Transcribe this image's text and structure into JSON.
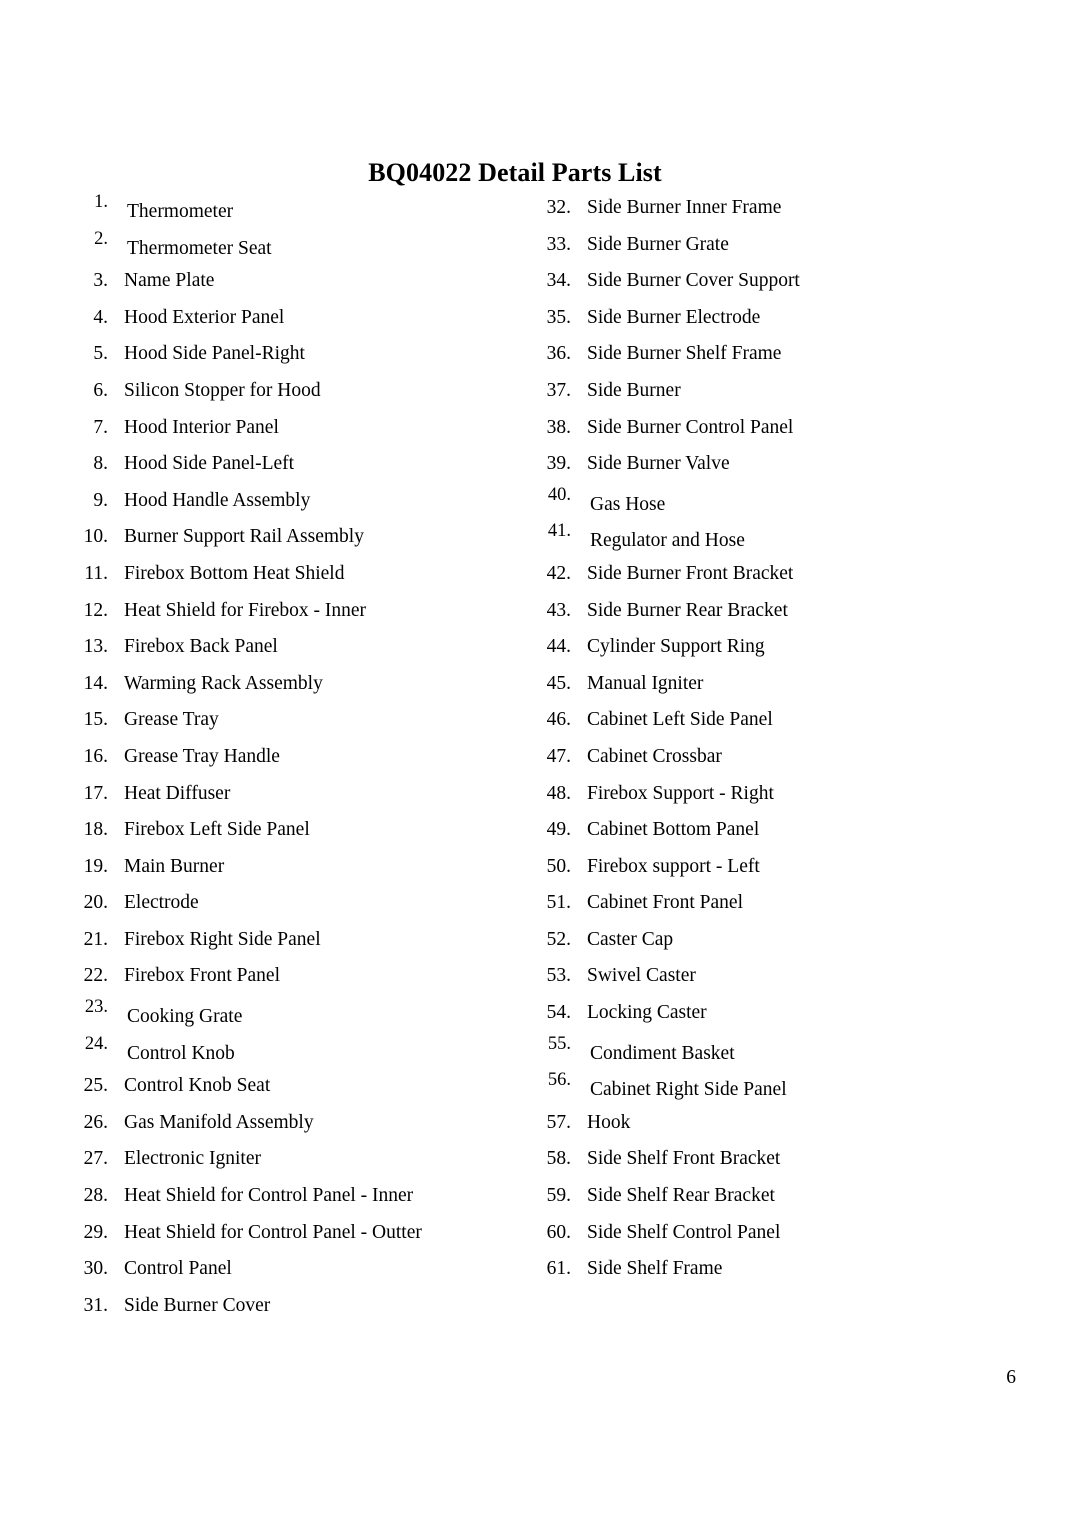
{
  "document": {
    "title": "BQ04022 Detail Parts List",
    "page_number": "6"
  },
  "parts_list": {
    "left_column": [
      {
        "number": "1.",
        "label": "Thermometer",
        "shifted": true
      },
      {
        "number": "2.",
        "label": "Thermometer Seat",
        "shifted": true
      },
      {
        "number": "3.",
        "label": "Name Plate",
        "shifted": false
      },
      {
        "number": "4.",
        "label": "Hood Exterior Panel",
        "shifted": false
      },
      {
        "number": "5.",
        "label": "Hood Side Panel-Right",
        "shifted": false
      },
      {
        "number": "6.",
        "label": "Silicon Stopper for Hood",
        "shifted": false
      },
      {
        "number": "7.",
        "label": "Hood Interior Panel",
        "shifted": false
      },
      {
        "number": "8.",
        "label": "Hood Side Panel-Left",
        "shifted": false
      },
      {
        "number": "9.",
        "label": "Hood Handle Assembly",
        "shifted": false
      },
      {
        "number": "10.",
        "label": "Burner Support Rail Assembly",
        "shifted": false
      },
      {
        "number": "11.",
        "label": "Firebox Bottom Heat Shield",
        "shifted": false
      },
      {
        "number": "12.",
        "label": "Heat Shield for Firebox - Inner",
        "shifted": false
      },
      {
        "number": "13.",
        "label": "Firebox Back Panel",
        "shifted": false
      },
      {
        "number": "14.",
        "label": "Warming Rack Assembly",
        "shifted": false
      },
      {
        "number": "15.",
        "label": "Grease Tray",
        "shifted": false
      },
      {
        "number": "16.",
        "label": "Grease Tray Handle",
        "shifted": false
      },
      {
        "number": "17.",
        "label": "Heat Diffuser",
        "shifted": false
      },
      {
        "number": "18.",
        "label": "Firebox Left Side Panel",
        "shifted": false
      },
      {
        "number": "19.",
        "label": "Main Burner",
        "shifted": false
      },
      {
        "number": "20.",
        "label": "Electrode",
        "shifted": false
      },
      {
        "number": "21.",
        "label": "Firebox Right Side Panel",
        "shifted": false
      },
      {
        "number": "22.",
        "label": "Firebox Front Panel",
        "shifted": false
      },
      {
        "number": "23.",
        "label": "Cooking Grate",
        "shifted": true
      },
      {
        "number": "24.",
        "label": "Control Knob",
        "shifted": true
      },
      {
        "number": "25.",
        "label": "Control Knob Seat",
        "shifted": false
      },
      {
        "number": "26.",
        "label": "Gas Manifold Assembly",
        "shifted": false
      },
      {
        "number": "27.",
        "label": "Electronic Igniter",
        "shifted": false
      },
      {
        "number": "28.",
        "label": "Heat Shield for Control Panel - Inner",
        "shifted": false
      },
      {
        "number": "29.",
        "label": "Heat Shield for Control Panel - Outter",
        "shifted": false
      },
      {
        "number": "30.",
        "label": "Control Panel",
        "shifted": false
      },
      {
        "number": "31.",
        "label": "Side Burner Cover",
        "shifted": false
      }
    ],
    "right_column": [
      {
        "number": "32.",
        "label": "Side Burner Inner Frame",
        "shifted": false
      },
      {
        "number": "33.",
        "label": "Side Burner Grate",
        "shifted": false
      },
      {
        "number": "34.",
        "label": "Side Burner Cover Support",
        "shifted": false
      },
      {
        "number": "35.",
        "label": "Side Burner Electrode",
        "shifted": false
      },
      {
        "number": "36.",
        "label": "Side Burner Shelf Frame",
        "shifted": false
      },
      {
        "number": "37.",
        "label": "Side Burner",
        "shifted": false
      },
      {
        "number": "38.",
        "label": "Side Burner Control Panel",
        "shifted": false
      },
      {
        "number": "39.",
        "label": "Side Burner Valve",
        "shifted": false
      },
      {
        "number": "40.",
        "label": "Gas Hose",
        "shifted": true
      },
      {
        "number": "41.",
        "label": "Regulator and Hose",
        "shifted": true
      },
      {
        "number": "42.",
        "label": "Side Burner Front Bracket",
        "shifted": false
      },
      {
        "number": "43.",
        "label": "Side Burner Rear Bracket",
        "shifted": false
      },
      {
        "number": "44.",
        "label": "Cylinder Support Ring",
        "shifted": false
      },
      {
        "number": "45.",
        "label": "Manual Igniter",
        "shifted": false
      },
      {
        "number": "46.",
        "label": "Cabinet Left Side Panel",
        "shifted": false
      },
      {
        "number": "47.",
        "label": "Cabinet Crossbar",
        "shifted": false
      },
      {
        "number": "48.",
        "label": "Firebox Support - Right",
        "shifted": false
      },
      {
        "number": "49.",
        "label": "Cabinet Bottom Panel",
        "shifted": false
      },
      {
        "number": "50.",
        "label": "Firebox support - Left",
        "shifted": false
      },
      {
        "number": "51.",
        "label": "Cabinet Front Panel",
        "shifted": false
      },
      {
        "number": "52.",
        "label": "Caster Cap",
        "shifted": false
      },
      {
        "number": "53.",
        "label": "Swivel Caster",
        "shifted": false
      },
      {
        "number": "54.",
        "label": "Locking Caster",
        "shifted": false
      },
      {
        "number": "55.",
        "label": "Condiment Basket",
        "shifted": true
      },
      {
        "number": "56.",
        "label": "Cabinet Right Side Panel",
        "shifted": true
      },
      {
        "number": "57.",
        "label": "Hook",
        "shifted": false
      },
      {
        "number": "58.",
        "label": "Side Shelf Front Bracket",
        "shifted": false
      },
      {
        "number": "59.",
        "label": "Side Shelf Rear Bracket",
        "shifted": false
      },
      {
        "number": "60.",
        "label": "Side Shelf Control Panel",
        "shifted": false
      },
      {
        "number": "61.",
        "label": "Side Shelf Frame",
        "shifted": false
      }
    ]
  }
}
